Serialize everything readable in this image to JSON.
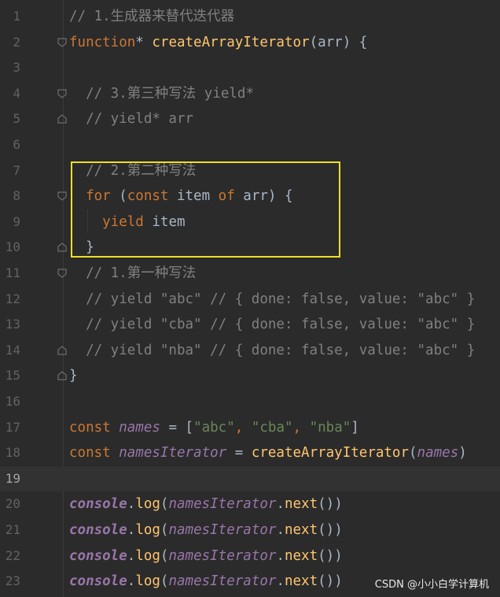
{
  "editor": {
    "lines": [
      {
        "n": "1",
        "fold": "",
        "tokens": [
          {
            "t": "// 1.生成器来替代迭代器",
            "c": "cm"
          }
        ]
      },
      {
        "n": "2",
        "fold": "open",
        "tokens": [
          {
            "t": "function",
            "c": "kw"
          },
          {
            "t": "* ",
            "c": "plain"
          },
          {
            "t": "createArrayIterator",
            "c": "fn"
          },
          {
            "t": "(arr) {",
            "c": "plain"
          }
        ]
      },
      {
        "n": "3",
        "fold": "",
        "tokens": []
      },
      {
        "n": "4",
        "fold": "open",
        "tokens": [
          {
            "t": "  // 3.第三种写法 yield*",
            "c": "cm"
          }
        ]
      },
      {
        "n": "5",
        "fold": "close",
        "tokens": [
          {
            "t": "  // yield* arr",
            "c": "cm"
          }
        ]
      },
      {
        "n": "6",
        "fold": "",
        "tokens": []
      },
      {
        "n": "7",
        "fold": "",
        "tokens": [
          {
            "t": "  // 2.第二种写法",
            "c": "cm"
          }
        ]
      },
      {
        "n": "8",
        "fold": "open",
        "tokens": [
          {
            "t": "  ",
            "c": "plain"
          },
          {
            "t": "for",
            "c": "kw"
          },
          {
            "t": " (",
            "c": "plain"
          },
          {
            "t": "const",
            "c": "kw"
          },
          {
            "t": " item ",
            "c": "plain"
          },
          {
            "t": "of",
            "c": "kw"
          },
          {
            "t": " arr) {",
            "c": "plain"
          }
        ]
      },
      {
        "n": "9",
        "fold": "",
        "tokens": [
          {
            "t": "    ",
            "c": "plain"
          },
          {
            "t": "yield",
            "c": "kw"
          },
          {
            "t": " item",
            "c": "plain"
          }
        ]
      },
      {
        "n": "10",
        "fold": "close",
        "tokens": [
          {
            "t": "  }",
            "c": "plain"
          }
        ]
      },
      {
        "n": "11",
        "fold": "open",
        "tokens": [
          {
            "t": "  // 1.第一种写法",
            "c": "cm"
          }
        ]
      },
      {
        "n": "12",
        "fold": "",
        "tokens": [
          {
            "t": "  // yield \"abc\" // { done: false, value: \"abc\" }",
            "c": "cm"
          }
        ]
      },
      {
        "n": "13",
        "fold": "",
        "tokens": [
          {
            "t": "  // yield \"cba\" // { done: false, value: \"abc\" }",
            "c": "cm"
          }
        ]
      },
      {
        "n": "14",
        "fold": "close",
        "tokens": [
          {
            "t": "  // yield \"nba\" // { done: false, value: \"abc\" }",
            "c": "cm"
          }
        ]
      },
      {
        "n": "15",
        "fold": "close",
        "tokens": [
          {
            "t": "}",
            "c": "plain"
          }
        ]
      },
      {
        "n": "16",
        "fold": "",
        "tokens": []
      },
      {
        "n": "17",
        "fold": "",
        "tokens": [
          {
            "t": "const",
            "c": "kw"
          },
          {
            "t": " ",
            "c": "plain"
          },
          {
            "t": "names",
            "c": "var"
          },
          {
            "t": " = [",
            "c": "plain"
          },
          {
            "t": "\"abc\"",
            "c": "str"
          },
          {
            "t": ", ",
            "c": "kw"
          },
          {
            "t": "\"cba\"",
            "c": "str"
          },
          {
            "t": ", ",
            "c": "kw"
          },
          {
            "t": "\"nba\"",
            "c": "str"
          },
          {
            "t": "]",
            "c": "plain"
          }
        ]
      },
      {
        "n": "18",
        "fold": "",
        "tokens": [
          {
            "t": "const",
            "c": "kw"
          },
          {
            "t": " ",
            "c": "plain"
          },
          {
            "t": "namesIterator",
            "c": "var"
          },
          {
            "t": " = ",
            "c": "plain"
          },
          {
            "t": "createArrayIterator",
            "c": "fn"
          },
          {
            "t": "(",
            "c": "plain"
          },
          {
            "t": "names",
            "c": "var"
          },
          {
            "t": ")",
            "c": "plain"
          }
        ]
      },
      {
        "n": "19",
        "fold": "",
        "current": true,
        "tokens": []
      },
      {
        "n": "20",
        "fold": "",
        "tokens": [
          {
            "t": "console",
            "c": "glob"
          },
          {
            "t": ".",
            "c": "plain"
          },
          {
            "t": "log",
            "c": "fn"
          },
          {
            "t": "(",
            "c": "plain"
          },
          {
            "t": "namesIterator",
            "c": "var"
          },
          {
            "t": ".",
            "c": "plain"
          },
          {
            "t": "next",
            "c": "fn"
          },
          {
            "t": "())",
            "c": "plain"
          }
        ]
      },
      {
        "n": "21",
        "fold": "",
        "tokens": [
          {
            "t": "console",
            "c": "glob"
          },
          {
            "t": ".",
            "c": "plain"
          },
          {
            "t": "log",
            "c": "fn"
          },
          {
            "t": "(",
            "c": "plain"
          },
          {
            "t": "namesIterator",
            "c": "var"
          },
          {
            "t": ".",
            "c": "plain"
          },
          {
            "t": "next",
            "c": "fn"
          },
          {
            "t": "())",
            "c": "plain"
          }
        ]
      },
      {
        "n": "22",
        "fold": "",
        "tokens": [
          {
            "t": "console",
            "c": "glob"
          },
          {
            "t": ".",
            "c": "plain"
          },
          {
            "t": "log",
            "c": "fn"
          },
          {
            "t": "(",
            "c": "plain"
          },
          {
            "t": "namesIterator",
            "c": "var"
          },
          {
            "t": ".",
            "c": "plain"
          },
          {
            "t": "next",
            "c": "fn"
          },
          {
            "t": "())",
            "c": "plain"
          }
        ]
      },
      {
        "n": "23",
        "fold": "",
        "tokens": [
          {
            "t": "console",
            "c": "glob"
          },
          {
            "t": ".",
            "c": "plain"
          },
          {
            "t": "log",
            "c": "fn"
          },
          {
            "t": "(",
            "c": "plain"
          },
          {
            "t": "namesIterator",
            "c": "var"
          },
          {
            "t": ".",
            "c": "plain"
          },
          {
            "t": "next",
            "c": "fn"
          },
          {
            "t": "())",
            "c": "plain"
          }
        ]
      }
    ]
  },
  "watermark": "CSDN @小小白学计算机",
  "colors": {
    "background": "#2b2b2b",
    "keyword": "#cc7832",
    "function": "#ffc66d",
    "string": "#6a8759",
    "comment": "#808080",
    "variable": "#9876aa",
    "highlight_box": "#f0e020"
  }
}
